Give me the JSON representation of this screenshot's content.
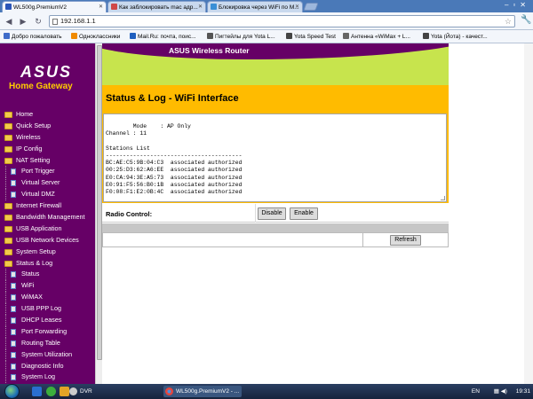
{
  "browser": {
    "tabs": [
      {
        "label": "WL500g.PremiumV2",
        "active": true
      },
      {
        "label": "Как заблокировать mac адр...",
        "active": false
      },
      {
        "label": "Блокировка через WiFi по M...",
        "active": false
      }
    ],
    "url": "192.168.1.1",
    "bookmarks": [
      "Добро пожаловать",
      "Одноклассники",
      "Mail.Ru: почта, поис...",
      "Пигтейлы для Yota L...",
      "Yota Speed Test",
      "Антенна «WiMax + L...",
      "Yota (Йота) - качест..."
    ]
  },
  "sidebar": {
    "logo": "ASUS",
    "subtitle": "Home Gateway",
    "items": [
      {
        "label": "Home",
        "level": 0
      },
      {
        "label": "Quick Setup",
        "level": 0
      },
      {
        "label": "Wireless",
        "level": 0
      },
      {
        "label": "IP Config",
        "level": 0
      },
      {
        "label": "NAT Setting",
        "level": 0
      },
      {
        "label": "Port Trigger",
        "level": 1
      },
      {
        "label": "Virtual Server",
        "level": 1
      },
      {
        "label": "Virtual DMZ",
        "level": 1
      },
      {
        "label": "Internet Firewall",
        "level": 0
      },
      {
        "label": "Bandwidth Management",
        "level": 0
      },
      {
        "label": "USB Application",
        "level": 0
      },
      {
        "label": "USB Network Devices",
        "level": 0
      },
      {
        "label": "System Setup",
        "level": 0
      },
      {
        "label": "Status & Log",
        "level": 0
      },
      {
        "label": "Status",
        "level": 1
      },
      {
        "label": "WiFi",
        "level": 1
      },
      {
        "label": "WiMAX",
        "level": 1
      },
      {
        "label": "USB PPP Log",
        "level": 1
      },
      {
        "label": "DHCP Leases",
        "level": 1
      },
      {
        "label": "Port Forwarding",
        "level": 1
      },
      {
        "label": "Routing Table",
        "level": 1
      },
      {
        "label": "System Utilization",
        "level": 1
      },
      {
        "label": "Diagnostic Info",
        "level": 1
      },
      {
        "label": "System Log",
        "level": 1
      }
    ]
  },
  "main": {
    "banner_title": "ASUS Wireless Router",
    "page_title": "Status & Log - WiFi Interface",
    "log_text": "Mode    : AP Only\nChannel : 11\n\nStations List\n----------------------------------------\nBC:AE:C5:9B:04:C3  associated authorized\n00:25:D3:62:A6:EE  associated authorized\nE0:CA:94:3E:A5:73  associated authorized\nE0:91:F5:56:B0:1B  associated authorized\nF0:08:F1:E2:0B:4C  associated authorized",
    "radio_label": "Radio Control:",
    "disable_label": "Disable",
    "enable_label": "Enable",
    "refresh_label": "Refresh"
  },
  "taskbar": {
    "items": [
      "DVR",
      "WL500g.PremiumV2 - ..."
    ],
    "lang": "EN",
    "time": "19:31"
  }
}
